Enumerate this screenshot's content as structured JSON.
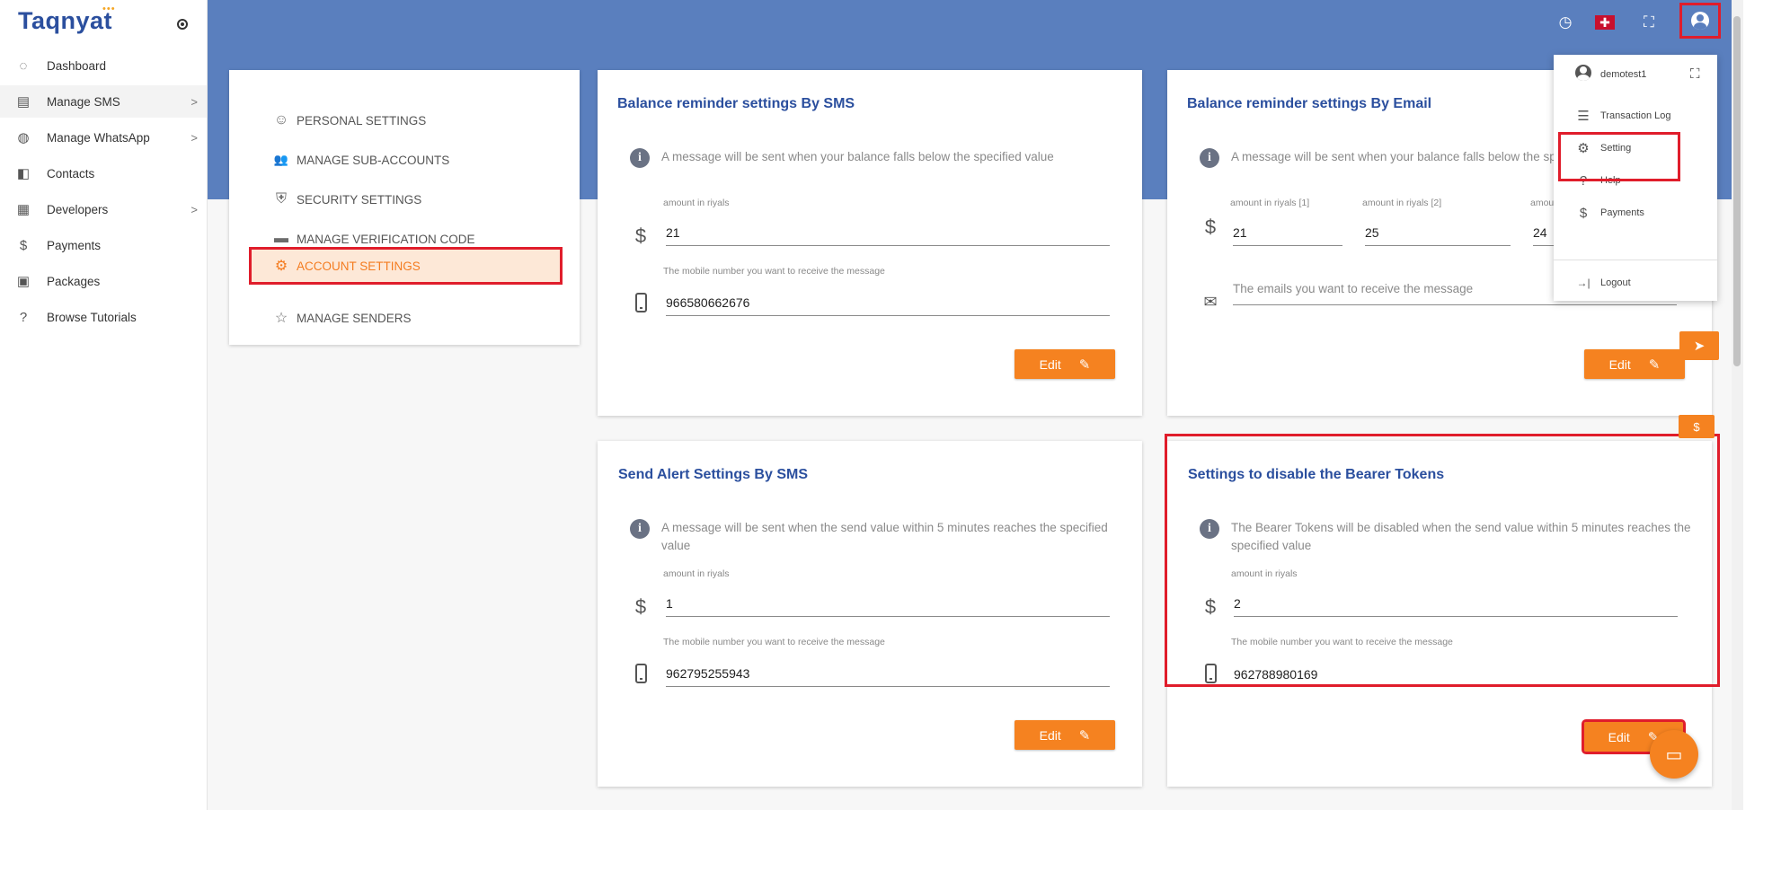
{
  "sidebar": {
    "brand": "Taqnyat",
    "brand_dots": "•••",
    "items": [
      {
        "label": "Dashboard",
        "icon": "palette-icon",
        "glyph": "◌",
        "chevron": ""
      },
      {
        "label": "Manage SMS",
        "icon": "message-icon",
        "glyph": "▤",
        "chevron": ">"
      },
      {
        "label": "Manage WhatsApp",
        "icon": "whatsapp-icon",
        "glyph": "◍",
        "chevron": ">"
      },
      {
        "label": "Contacts",
        "icon": "contacts-book-icon",
        "glyph": "◧",
        "chevron": ""
      },
      {
        "label": "Developers",
        "icon": "developers-icon",
        "glyph": "▦",
        "chevron": ">"
      },
      {
        "label": "Payments",
        "icon": "dollar-icon",
        "glyph": "$",
        "chevron": ""
      },
      {
        "label": "Packages",
        "icon": "package-icon",
        "glyph": "▣",
        "chevron": ""
      },
      {
        "label": "Browse Tutorials",
        "icon": "help-icon",
        "glyph": "?",
        "chevron": ""
      }
    ]
  },
  "header": {
    "icons": [
      {
        "name": "history-icon",
        "glyph": "◷"
      },
      {
        "name": "uk-flag-icon",
        "glyph": "✚"
      },
      {
        "name": "fullscreen-icon",
        "glyph": "⛶"
      }
    ]
  },
  "settings_menu": {
    "items": [
      {
        "label": "PERSONAL SETTINGS",
        "glyph": "☺",
        "icon": "face-icon"
      },
      {
        "label": "MANAGE SUB-ACCOUNTS",
        "glyph": "👥",
        "icon": "people-icon"
      },
      {
        "label": "SECURITY SETTINGS",
        "glyph": "⛨",
        "icon": "shield-icon"
      },
      {
        "label": "MANAGE VERIFICATION CODE",
        "glyph": "▬",
        "icon": "message-dots-icon"
      },
      {
        "label": "ACCOUNT SETTINGS",
        "glyph": "⚙",
        "icon": "gear-icon"
      },
      {
        "label": "MANAGE SENDERS",
        "glyph": "☆",
        "icon": "star-icon"
      }
    ]
  },
  "cards": {
    "balance_sms": {
      "title": "Balance reminder settings By SMS",
      "info": "A message will be sent when your balance falls below the specified value",
      "amount_label": "amount in riyals",
      "amount_value": "21",
      "mobile_label": "The mobile number you want to receive the message",
      "mobile_value": "966580662676",
      "edit_label": "Edit"
    },
    "balance_email": {
      "title": "Balance reminder settings By Email",
      "info": "A message will be sent when your balance falls below the spec",
      "amount1_label": "amount in riyals [1]",
      "amount1_value": "21",
      "amount2_label": "amount in riyals [2]",
      "amount2_value": "25",
      "amount3_label": "amou",
      "amount3_value": "24",
      "emails_placeholder": "The emails you want to receive the message",
      "edit_label": "Edit"
    },
    "alert_sms": {
      "title": "Send Alert Settings By SMS",
      "info_line1": "A message will be sent when the send value within 5 minutes reaches the specified",
      "info_line2": "value",
      "amount_label": "amount in riyals",
      "amount_value": "1",
      "mobile_label": "The mobile number you want to receive the message",
      "mobile_value": "962795255943",
      "edit_label": "Edit"
    },
    "bearer": {
      "title": "Settings to disable the Bearer Tokens",
      "info_line1": "The Bearer Tokens will be disabled when the send value within 5 minutes reaches the",
      "info_line2": "specified value",
      "amount_label": "amount in riyals",
      "amount_value": "2",
      "mobile_label": "The mobile number you want to receive the message",
      "mobile_value": "962788980169",
      "edit_label": "Edit"
    }
  },
  "dropdown": {
    "username": "demotest1",
    "items": [
      {
        "label": "Transaction Log",
        "glyph": "☰",
        "icon": "list-icon"
      },
      {
        "label": "Setting",
        "glyph": "⚙",
        "icon": "gear-icon"
      },
      {
        "label": "Help",
        "glyph": "?",
        "icon": "help-icon"
      },
      {
        "label": "Payments",
        "glyph": "$",
        "icon": "dollar-icon"
      },
      {
        "label": "Logout",
        "glyph": "→|",
        "icon": "logout-icon"
      }
    ]
  },
  "floating": {
    "send_glyph": "➤",
    "dollar_glyph": "$",
    "chat_glyph": "▭"
  },
  "colors": {
    "header_blue": "#5a7fbe",
    "brand_blue": "#2b4f9e",
    "accent_orange": "#f58220",
    "highlight_red": "#e01d2b"
  }
}
